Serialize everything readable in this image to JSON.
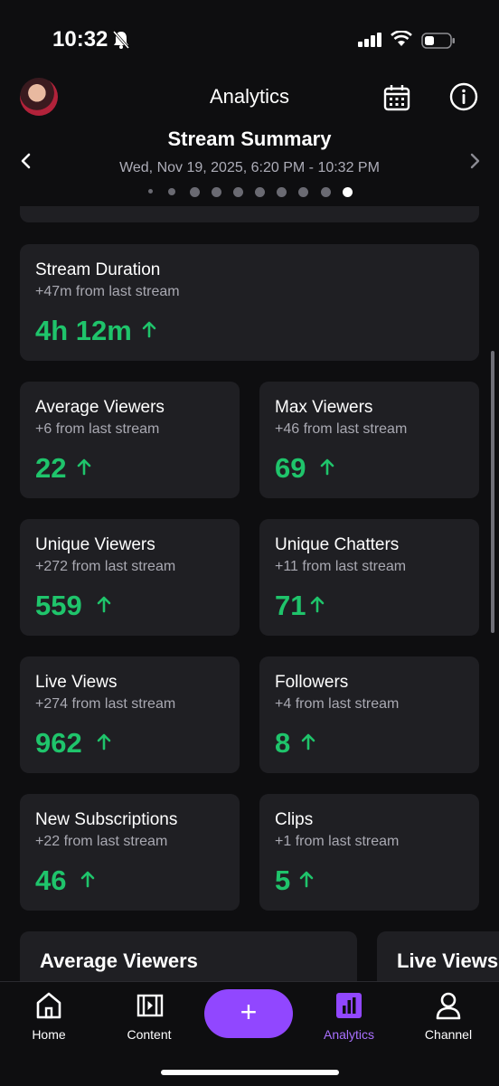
{
  "status_bar": {
    "time": "10:32"
  },
  "header": {
    "title": "Analytics"
  },
  "summary": {
    "title": "Stream Summary",
    "date_range": "Wed, Nov 19, 2025, 6:20 PM - 10:32 PM",
    "pager": {
      "count": 10,
      "active": 9
    }
  },
  "stats": {
    "stream_duration": {
      "label": "Stream Duration",
      "change": "+47m from last stream",
      "value": "4h 12m"
    },
    "average_viewers": {
      "label": "Average Viewers",
      "change": "+6 from last stream",
      "value": "22"
    },
    "max_viewers": {
      "label": "Max Viewers",
      "change": "+46 from last stream",
      "value": "69"
    },
    "unique_viewers": {
      "label": "Unique Viewers",
      "change": "+272 from last stream",
      "value": "559"
    },
    "unique_chatters": {
      "label": "Unique Chatters",
      "change": "+11 from last stream",
      "value": "71"
    },
    "live_views": {
      "label": "Live Views",
      "change": "+274 from last stream",
      "value": "962"
    },
    "followers": {
      "label": "Followers",
      "change": "+4 from last stream",
      "value": "8"
    },
    "new_subscriptions": {
      "label": "New Subscriptions",
      "change": "+22 from last stream",
      "value": "46"
    },
    "clips": {
      "label": "Clips",
      "change": "+1 from last stream",
      "value": "5"
    }
  },
  "chart_cards": [
    {
      "title": "Average Viewers"
    },
    {
      "title": "Live Views"
    }
  ],
  "bottom_nav": {
    "home": "Home",
    "content": "Content",
    "create": "+",
    "analytics": "Analytics",
    "channel": "Channel"
  },
  "colors": {
    "accent": "#9147ff",
    "positive": "#1fc46b",
    "card_bg": "#1f1f23",
    "bg": "#0e0e10"
  }
}
